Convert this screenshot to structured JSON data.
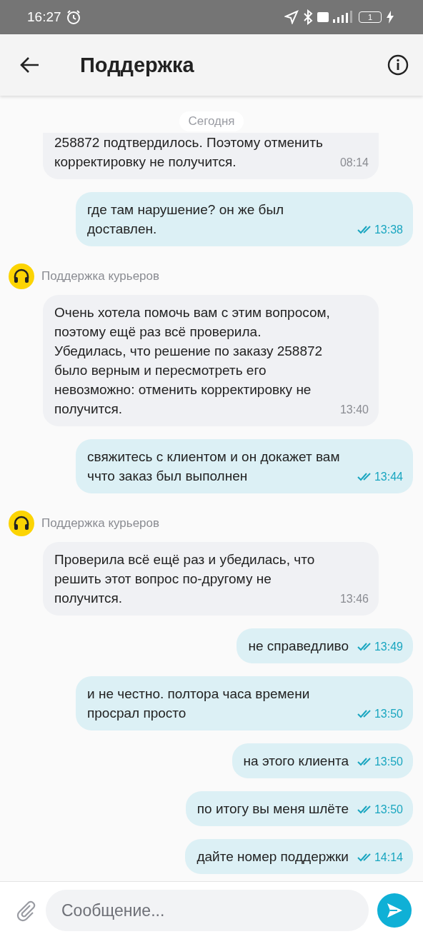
{
  "status_bar": {
    "time": "16:27",
    "battery": "1"
  },
  "header": {
    "title": "Поддержка"
  },
  "date_chip": "Сегодня",
  "messages": [
    {
      "kind": "in",
      "cut": true,
      "text": "258872 подтвердилось. Поэтому отменить корректировку не получится.",
      "time": "08:14"
    },
    {
      "kind": "out",
      "text": "где там нарушение? он же был доставлен.",
      "time": "13:38",
      "read": true
    },
    {
      "kind": "sender",
      "name": "Поддержка курьеров"
    },
    {
      "kind": "in",
      "cut": false,
      "text": "Очень хотела помочь вам с этим вопросом, поэтому ещё раз всё проверила. Убедилась, что решение по заказу 258872  было верным и пересмотреть его невозможно: отменить корректировку не получится.",
      "time": "13:40"
    },
    {
      "kind": "out",
      "text": "свяжитесь с клиентом и он докажет вам ччто заказ был выполнен",
      "time": "13:44",
      "read": true
    },
    {
      "kind": "sender",
      "name": "Поддержка курьеров"
    },
    {
      "kind": "in",
      "cut": false,
      "text": "Проверила всё ещё раз и убедилась, что решить этот вопрос по-другому не получится.",
      "time": "13:46"
    },
    {
      "kind": "out",
      "text": "не справедливо",
      "time": "13:49",
      "read": true
    },
    {
      "kind": "out",
      "text": "и не честно. полтора часа времени просрал просто",
      "time": "13:50",
      "read": true
    },
    {
      "kind": "out",
      "text": "на этого клиента",
      "time": "13:50",
      "read": true
    },
    {
      "kind": "out",
      "text": "по итогу вы меня шлёте",
      "time": "13:50",
      "read": true
    },
    {
      "kind": "out",
      "text": "дайте номер поддержки",
      "time": "14:14",
      "read": true
    }
  ],
  "composer": {
    "placeholder": "Сообщение..."
  }
}
